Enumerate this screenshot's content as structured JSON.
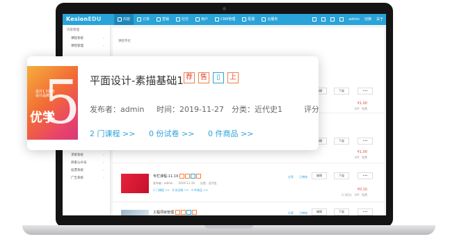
{
  "app": {
    "logo_main": "Kesion",
    "logo_accent": "EDU"
  },
  "nav": [
    {
      "label": "内容",
      "active": true
    },
    {
      "label": "订单"
    },
    {
      "label": "营销"
    },
    {
      "label": "社交"
    },
    {
      "label": "用户"
    },
    {
      "label": "CRM管理"
    },
    {
      "label": "配置"
    },
    {
      "label": "云服务"
    }
  ],
  "topbar_right": {
    "user": "admin",
    "switch": "切换",
    "about": "关于"
  },
  "sidebar": {
    "title": "内容管理",
    "items": [
      "课程系统",
      "课程管理",
      "",
      "",
      "",
      "",
      "",
      "",
      "",
      "",
      "",
      "",
      "",
      "",
      "友情链接系统",
      "自定义表单",
      "求职系统",
      "商家公众号",
      "投票系统",
      "广告系统"
    ]
  },
  "main": {
    "crumb": "课程专栏"
  },
  "rows": [
    {
      "price": "¥1.00",
      "vip": "VIP：免费"
    },
    {
      "price": "¥1.00",
      "vip": "VIP：免费"
    },
    {
      "title": "专栏课程-11.19",
      "meta": "发布者：admin　　2019-11-19　　分类：近代史",
      "links": [
        "1 门课程 >>",
        "0 份试卷 >>",
        "0 件商品 >>"
      ],
      "price": "¥0.10",
      "vip": "0.1积分　VIP：免费",
      "actions": [
        "分享",
        "已审核"
      ]
    },
    {
      "title": "工程项目管理",
      "actions": [
        "分享",
        "已审核"
      ]
    }
  ],
  "row_buttons": {
    "edit": "编辑",
    "down": "下架",
    "more": "•••"
  },
  "card": {
    "title": "平面设计-素描基础1",
    "tags": [
      "荐",
      "售",
      "▯",
      "上"
    ],
    "publisher": "发布者：admin",
    "time": "时间：2019-11-27",
    "category": "分类：近代史1",
    "rating": "评分",
    "links": [
      "2 门课程 >>",
      "0 份试卷 >>",
      "0 件商品 >>"
    ],
    "cover_number": "5",
    "cover_word": "优学",
    "cover_small": "设计1 5周年\n设计品牌"
  },
  "colors": {
    "primary": "#2aa3d8",
    "price": "#e2483a",
    "tag": "#f08040"
  }
}
